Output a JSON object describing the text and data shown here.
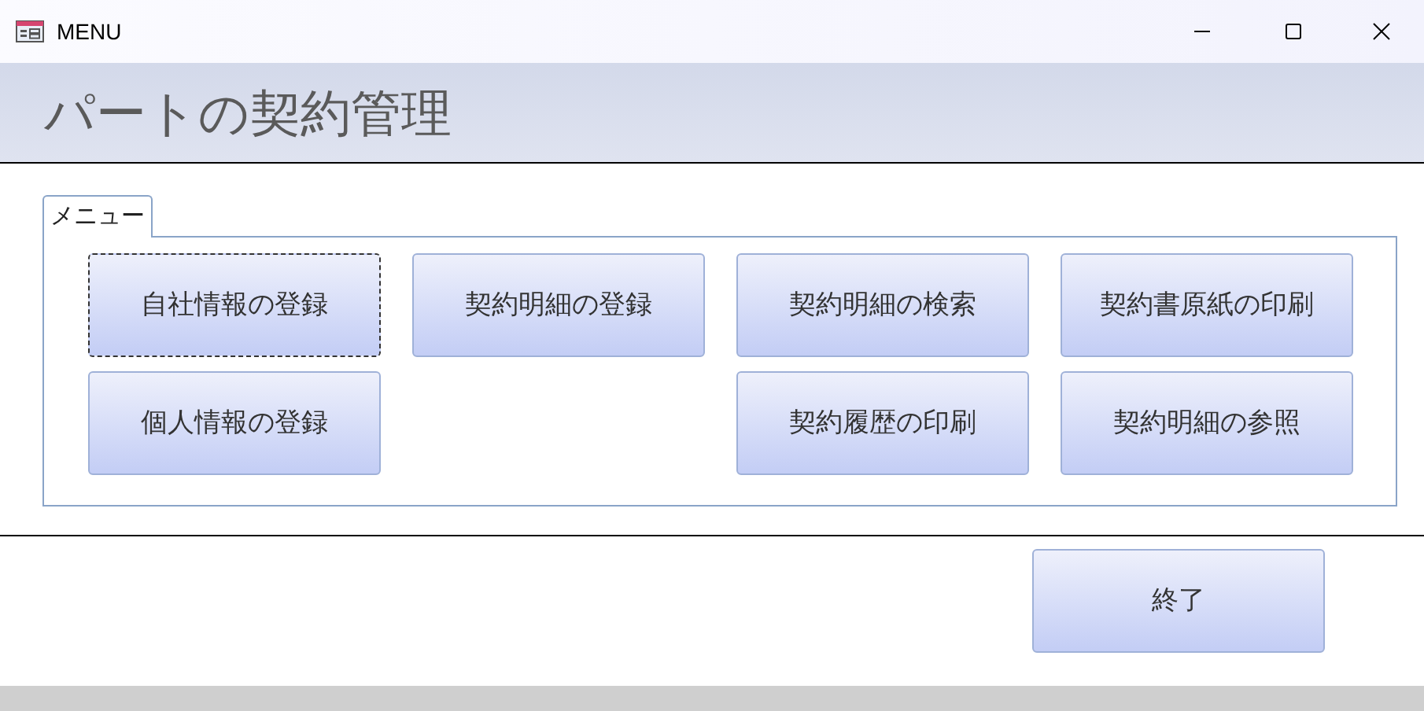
{
  "window": {
    "title": "MENU"
  },
  "header": {
    "title": "パートの契約管理"
  },
  "tab": {
    "label": "メニュー",
    "selected": true
  },
  "menu_rows": [
    [
      {
        "label": "自社情報の登録",
        "focused": true
      },
      {
        "label": "契約明細の登録",
        "focused": false
      },
      {
        "label": "契約明細の検索",
        "focused": false
      },
      {
        "label": "契約書原紙の印刷",
        "focused": false
      }
    ],
    [
      {
        "label": "個人情報の登録",
        "focused": false
      },
      null,
      {
        "label": "契約履歴の印刷",
        "focused": false
      },
      {
        "label": "契約明細の参照",
        "focused": false
      }
    ]
  ],
  "exit_button": {
    "label": "終了"
  }
}
